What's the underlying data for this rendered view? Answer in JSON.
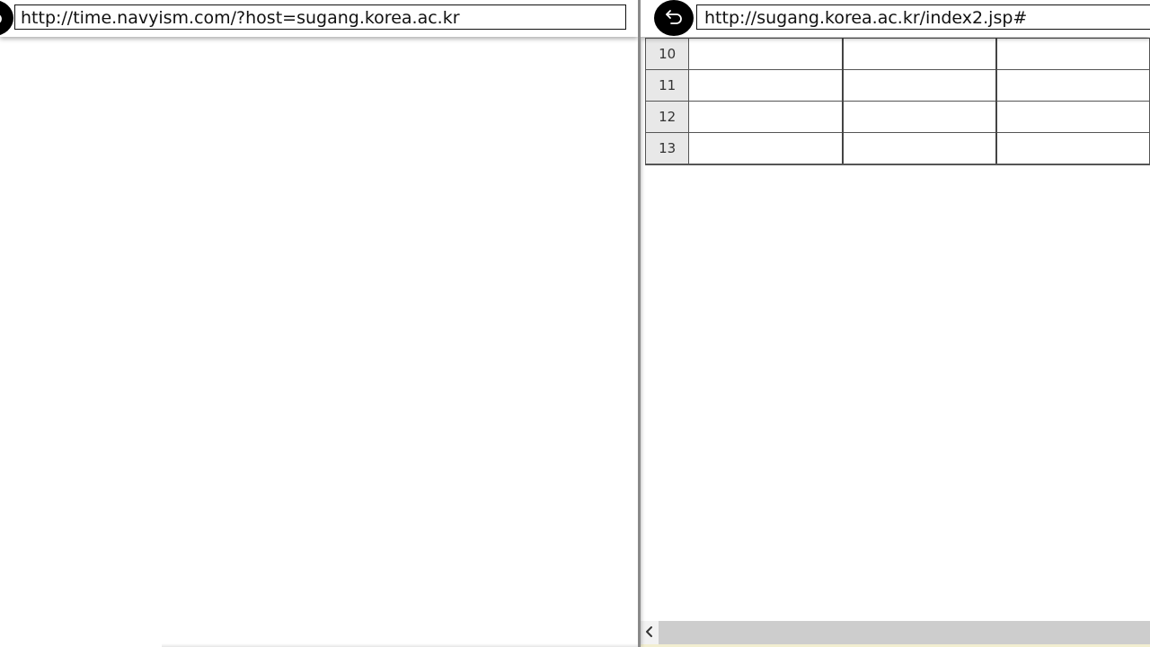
{
  "left_pane": {
    "url": "http://time.navyism.com/?host=sugang.korea.ac.kr",
    "back_icon": "back-arrow-icon"
  },
  "right_pane": {
    "url": "http://sugang.korea.ac.kr/index2.jsp#",
    "back_icon": "back-arrow-icon",
    "timetable": {
      "rows": [
        {
          "period": "10"
        },
        {
          "period": "11"
        },
        {
          "period": "12"
        },
        {
          "period": "13"
        }
      ]
    },
    "scrollbar_icon": "chevron-left-icon"
  }
}
